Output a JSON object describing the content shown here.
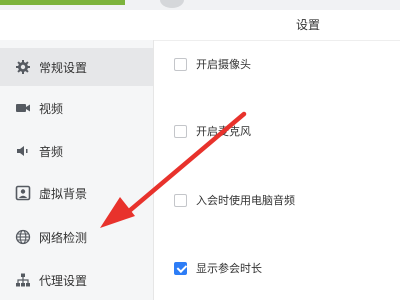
{
  "window": {
    "title": "设置"
  },
  "sidebar": {
    "items": [
      {
        "label": "常规设置",
        "icon": "gear-icon",
        "active": true
      },
      {
        "label": "视频",
        "icon": "video-camera-icon",
        "active": false
      },
      {
        "label": "音频",
        "icon": "speaker-icon",
        "active": false
      },
      {
        "label": "虚拟背景",
        "icon": "portrait-icon",
        "active": false
      },
      {
        "label": "网络检测",
        "icon": "globe-icon",
        "active": false
      },
      {
        "label": "代理设置",
        "icon": "network-hierarchy-icon",
        "active": false
      }
    ]
  },
  "options": [
    {
      "label": "开启摄像头",
      "checked": false
    },
    {
      "label": "开启麦克风",
      "checked": false
    },
    {
      "label": "入会时使用电脑音频",
      "checked": false
    },
    {
      "label": "显示参会时长",
      "checked": true
    }
  ],
  "colors": {
    "accent_green": "#7db33c",
    "checkbox_blue": "#2d7df6",
    "annotation_red": "#e8322c",
    "sidebar_bg": "#f5f6f7",
    "active_item_bg": "#e6e7e9"
  }
}
